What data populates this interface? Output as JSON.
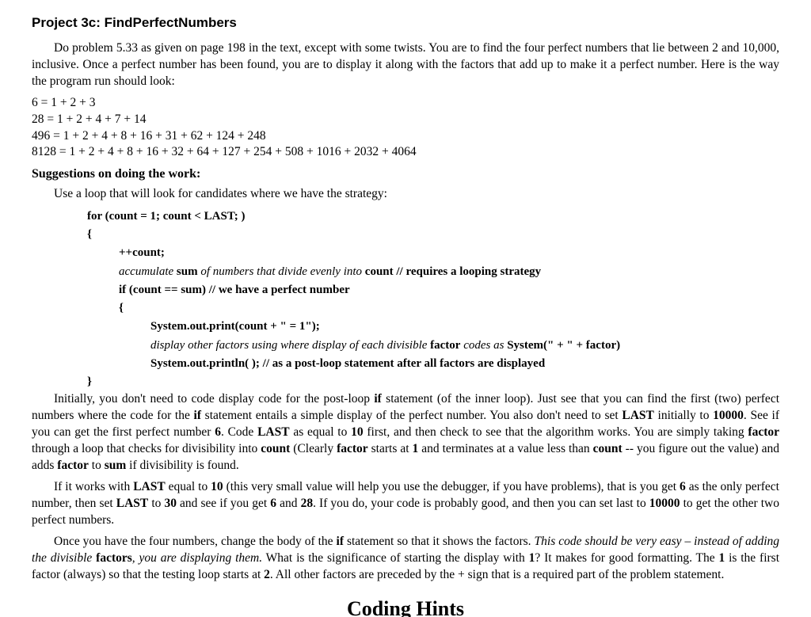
{
  "title": "Project 3c: FindPerfectNumbers",
  "intro": "Do problem 5.33 as given on page 198 in the text, except with some twists. You are to find the four perfect numbers that lie between 2 and 10,000, inclusive. Once a perfect number has been found, you are to display it along with the factors that add up to make it a perfect number. Here is the way the program run should look:",
  "outputs": [
    "6 = 1  + 2 + 3",
    "28 = 1  + 2 + 4 + 7 + 14",
    "496 = 1  + 2 + 4 + 8 + 16 + 31 + 62 + 124 + 248",
    "8128 = 1  + 2 + 4 + 8 + 16 + 32 + 64 + 127 + 254 + 508 + 1016 + 2032 + 4064"
  ],
  "suggestions_header": "Suggestions on doing the work:",
  "use_loop": "Use a loop that will look for candidates where we have the strategy:",
  "code": {
    "l1": "for (count = 1; count < LAST; )",
    "l2": "{",
    "l3": "++count;",
    "l4_em": "accumulate ",
    "l4_b1": "sum",
    "l4_em2": " of numbers that divide evenly into ",
    "l4_b2": "count",
    "l4_tail": "   // requires a looping strategy",
    "l5": "if (count == sum)   // we have a perfect number",
    "l6": "{",
    "l7": "System.out.print(count + \" = 1\");",
    "l8_em": "display other factors using where display of each divisible ",
    "l8_b1": "factor",
    "l8_em2": " codes as  ",
    "l8_b2": "System(\" + \" + factor)",
    "l9": "System.out.println( );   // as a post-loop statement after all factors are displayed",
    "l10": "}"
  },
  "para2_a": "Initially, you don't need to code display code for the post-loop ",
  "para2_b": "if",
  "para2_c": " statement (of the inner loop). Just see that you can find the first (two) perfect numbers where the code for the ",
  "para2_d": "if",
  "para2_e": " statement entails a simple display of the perfect number. You also don't need to set ",
  "para2_f": "LAST",
  "para2_g": " initially to ",
  "para2_h": "10000",
  "para2_i": ". See if you can get the first perfect number ",
  "para2_j": "6",
  "para2_k": ". Code ",
  "para2_l": "LAST",
  "para2_m": " as equal to ",
  "para2_n": "10",
  "para2_o": " first, and then check to see that the algorithm works. You are simply taking ",
  "para2_p": "factor",
  "para2_q": " through a loop that checks for divisibility into ",
  "para2_r": "count",
  "para2_s": " (Clearly ",
  "para2_t": "factor",
  "para2_u": " starts at ",
  "para2_v": "1",
  "para2_w": " and terminates at a value less than ",
  "para2_x": "count",
  "para2_y": " -- you figure out the value) and adds ",
  "para2_z": "factor",
  "para2_aa": " to ",
  "para2_ab": "sum",
  "para2_ac": " if divisibility is found.",
  "para3_a": "If it works with ",
  "para3_b": "LAST",
  "para3_c": " equal to ",
  "para3_d": "10",
  "para3_e": " (this very small value will help you use the debugger, if you have problems), that is you get ",
  "para3_f": "6",
  "para3_g": " as the only perfect number, then set ",
  "para3_h": "LAST",
  "para3_i": " to ",
  "para3_j": "30",
  "para3_k": " and see if you get ",
  "para3_l": "6",
  "para3_m": " and ",
  "para3_n": "28",
  "para3_o": ". If you do, your code is probably good, and then you can set last to ",
  "para3_p": "10000",
  "para3_q": " to get the other two perfect numbers.",
  "para4_a": "Once you have the four numbers, change the body of the ",
  "para4_b": "if",
  "para4_c": " statement so that it shows the factors. ",
  "para4_d": "This code should be very easy – instead of adding the divisible ",
  "para4_e": "factors",
  "para4_f": ", you are displaying them.",
  "para4_g": " What is the significance of starting the display with ",
  "para4_h": "1",
  "para4_i": "? It makes for good formatting. The ",
  "para4_j": "1",
  "para4_k": " is the first factor (always) so that the testing loop starts at ",
  "para4_l": "2",
  "para4_m": ". All other factors are preceded by the + sign that is a required part of the problem statement.",
  "footer": "Coding Hints"
}
